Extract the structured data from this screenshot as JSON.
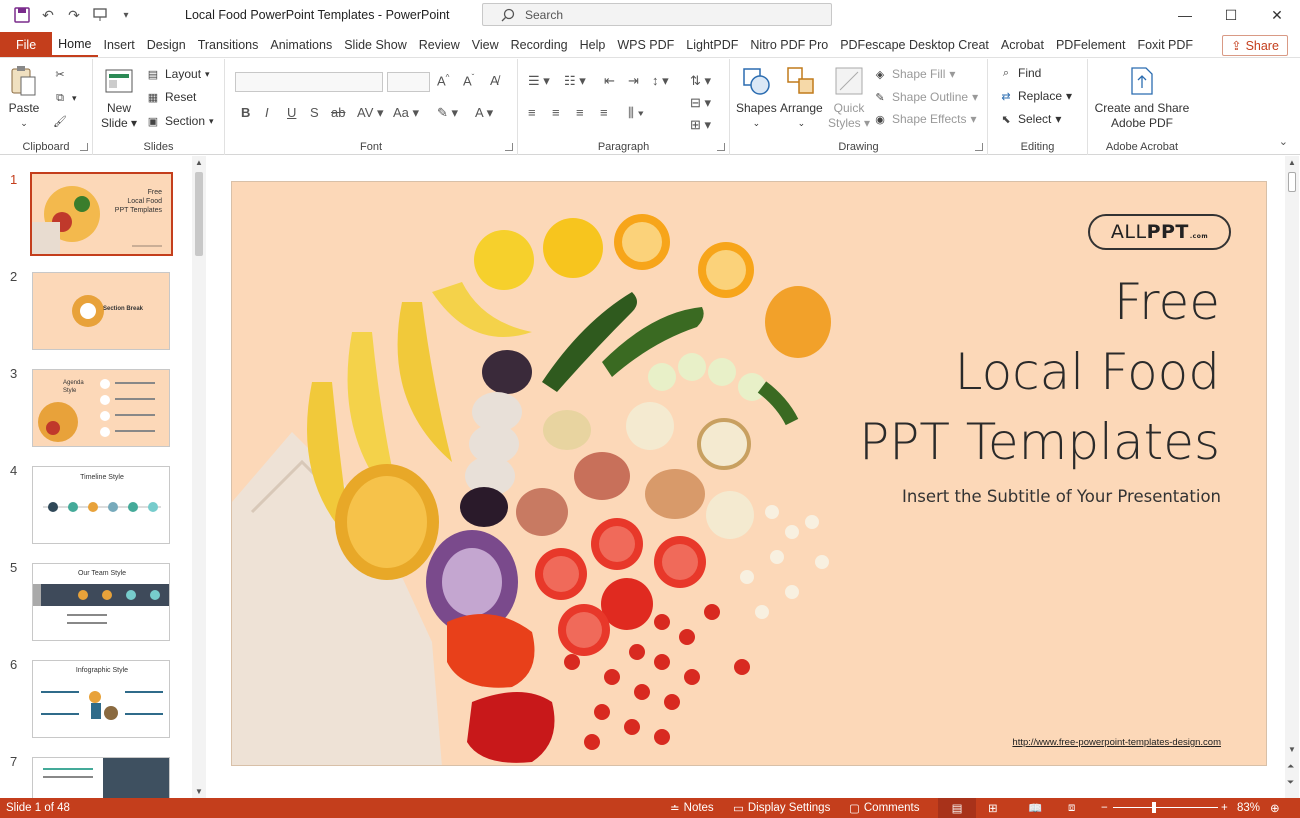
{
  "window": {
    "doc_title": "Local Food PowerPoint Templates  -  PowerPoint",
    "search_placeholder": "Search"
  },
  "tabs": [
    "File",
    "Home",
    "Insert",
    "Design",
    "Transitions",
    "Animations",
    "Slide Show",
    "Review",
    "View",
    "Recording",
    "Help",
    "WPS PDF",
    "LightPDF",
    "Nitro PDF Pro",
    "PDFescape Desktop Creat",
    "Acrobat",
    "PDFelement",
    "Foxit PDF"
  ],
  "active_tab": "Home",
  "share_label": "Share",
  "ribbon": {
    "clipboard": {
      "label": "Clipboard",
      "paste": "Paste"
    },
    "slides": {
      "label": "Slides",
      "new_slide_1": "New",
      "new_slide_2": "Slide",
      "layout": "Layout",
      "reset": "Reset",
      "section": "Section"
    },
    "font": {
      "label": "Font"
    },
    "paragraph": {
      "label": "Paragraph"
    },
    "drawing": {
      "label": "Drawing",
      "shapes": "Shapes",
      "arrange": "Arrange",
      "quick_styles_1": "Quick",
      "quick_styles_2": "Styles",
      "shape_fill": "Shape Fill",
      "shape_outline": "Shape Outline",
      "shape_effects": "Shape Effects"
    },
    "editing": {
      "label": "Editing",
      "find": "Find",
      "replace": "Replace",
      "select": "Select"
    },
    "acrobat": {
      "label": "Adobe Acrobat",
      "create_1": "Create and Share",
      "create_2": "Adobe PDF"
    }
  },
  "thumbnails": [
    {
      "num": "1",
      "title": "Free Local Food PPT Templates"
    },
    {
      "num": "2",
      "title": "Section Break"
    },
    {
      "num": "3",
      "title": "Agenda Style"
    },
    {
      "num": "4",
      "title": "Timeline Style"
    },
    {
      "num": "5",
      "title": "Our Team Style"
    },
    {
      "num": "6",
      "title": "Infographic Style"
    },
    {
      "num": "7",
      "title": ""
    }
  ],
  "slide": {
    "logo_pre": "ALL",
    "logo_bold": "PPT",
    "logo_com": ".com",
    "title_line1": "Free",
    "title_line2": "Local Food",
    "title_line3": "PPT Templates",
    "subtitle": "Insert the Subtitle of Your Presentation",
    "url": "http://www.free-powerpoint-templates-design.com",
    "bg_color": "#fcd8b8"
  },
  "status": {
    "slide_info": "Slide 1 of 48",
    "notes": "Notes",
    "display_settings": "Display Settings",
    "comments": "Comments",
    "zoom": "83%"
  },
  "colors": {
    "accent": "#c43e1c"
  }
}
